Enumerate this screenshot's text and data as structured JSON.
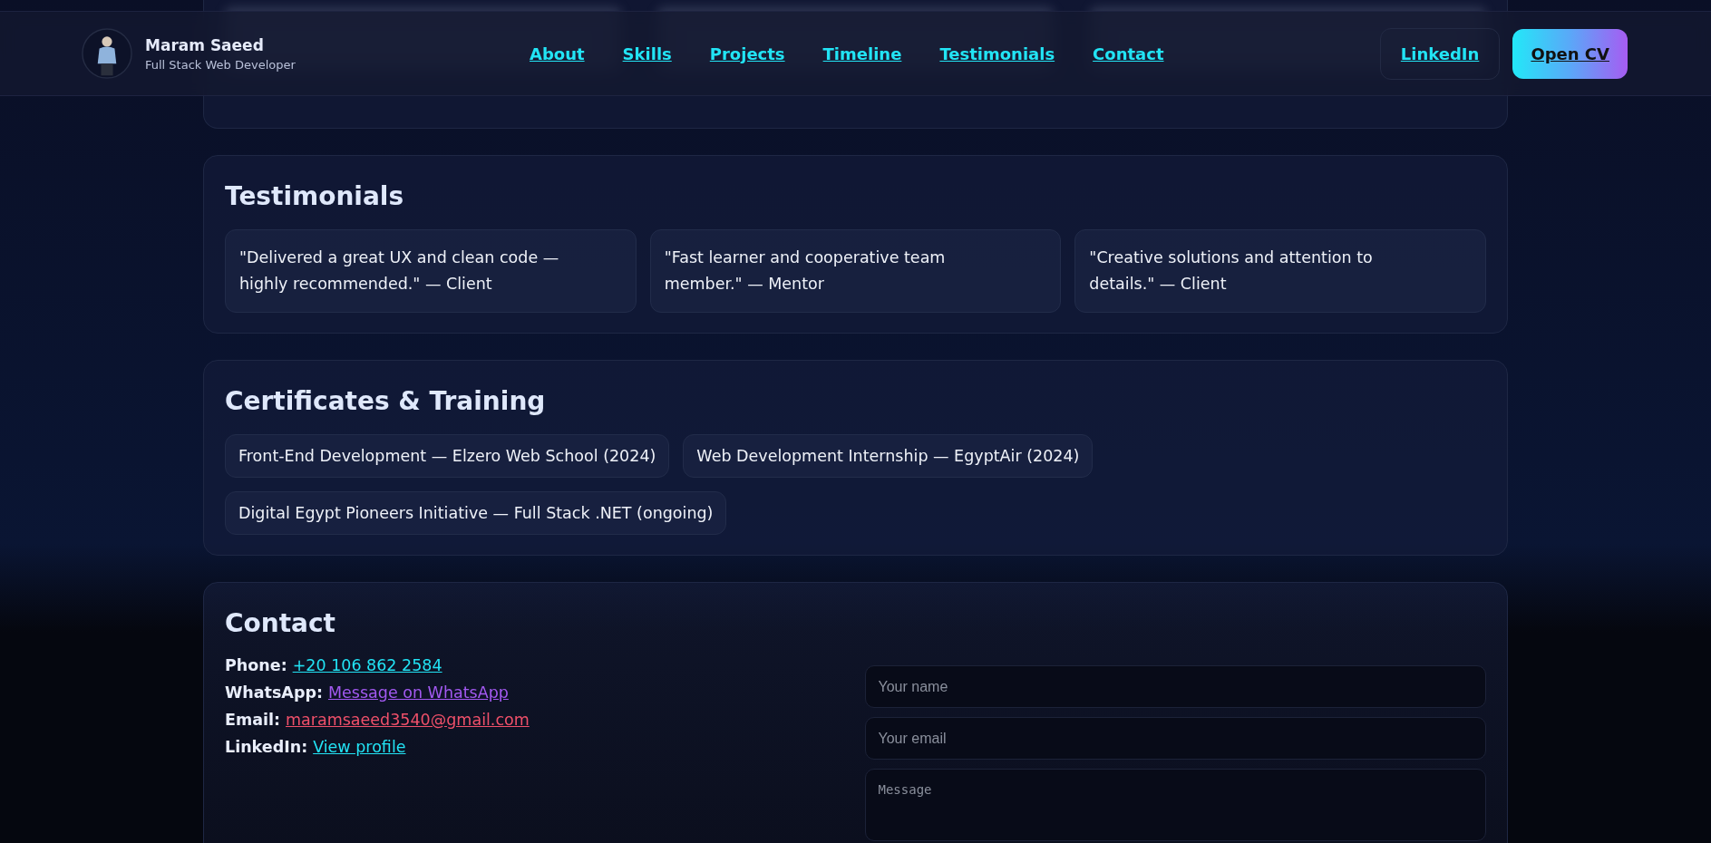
{
  "header": {
    "name": "Maram Saeed",
    "role": "Full Stack Web Developer",
    "nav": [
      {
        "label": "About"
      },
      {
        "label": "Skills"
      },
      {
        "label": "Projects"
      },
      {
        "label": "Timeline"
      },
      {
        "label": "Testimonials"
      },
      {
        "label": "Contact"
      }
    ],
    "linkedin_button": "LinkedIn",
    "cv_button": "Open CV"
  },
  "testimonials": {
    "title": "Testimonials",
    "items": [
      {
        "text": "\"Delivered a great UX and clean code — highly recommended.\" — Client"
      },
      {
        "text": "\"Fast learner and cooperative team member.\" — Mentor"
      },
      {
        "text": "\"Creative solutions and attention to details.\" — Client"
      }
    ]
  },
  "certificates": {
    "title": "Certificates & Training",
    "items": [
      "Front-End Development — Elzero Web School (2024)",
      "Web Development Internship — EgyptAir (2024)",
      "Digital Egypt Pioneers Initiative — Full Stack .NET (ongoing)"
    ]
  },
  "contact": {
    "title": "Contact",
    "lines": [
      {
        "label": "Phone:",
        "link": "+20 106 862 2584",
        "kind": "phone"
      },
      {
        "label": "WhatsApp:",
        "link": "Message on WhatsApp",
        "kind": "whatsapp"
      },
      {
        "label": "Email:",
        "link": "maramsaeed3540@gmail.com",
        "kind": "email"
      },
      {
        "label": "LinkedIn:",
        "link": "View profile",
        "kind": "linkedin"
      }
    ],
    "form": {
      "name_placeholder": "Your name",
      "email_placeholder": "Your email",
      "message_placeholder": "Message"
    }
  }
}
